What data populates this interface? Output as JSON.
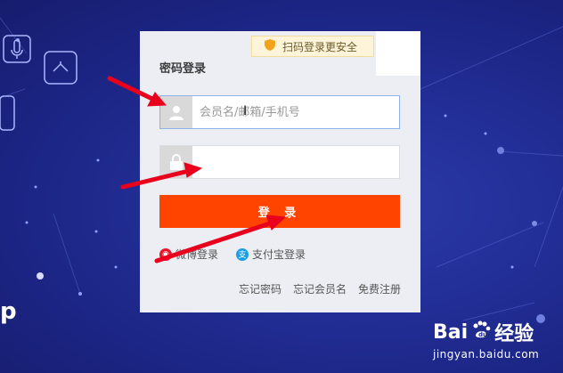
{
  "qr_tip": {
    "text": "扫码登录更安全",
    "icon": "shield-icon"
  },
  "login": {
    "title": "密码登录",
    "username_placeholder": "会员名/邮箱/手机号",
    "password_placeholder": "",
    "submit_label": "登 录"
  },
  "third_party": [
    {
      "label": "微博登录",
      "icon": "weibo-icon"
    },
    {
      "label": "支付宝登录",
      "icon": "alipay-icon"
    }
  ],
  "links": [
    {
      "label": "忘记密码"
    },
    {
      "label": "忘记会员名"
    },
    {
      "label": "免费注册"
    }
  ],
  "watermark": {
    "brand": "Bai",
    "suffix": "经验",
    "url": "jingyan.baidu.com"
  },
  "colors": {
    "accent": "#ff4400",
    "background": "#1f2a8c",
    "annotation": "#e8001c"
  }
}
